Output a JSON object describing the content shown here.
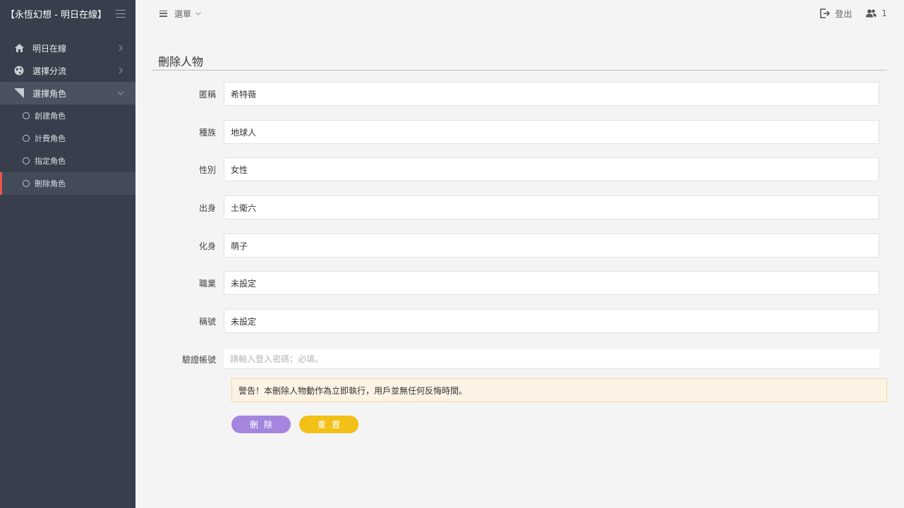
{
  "sidebar": {
    "brand": "【永恆幻想 - 明日在線】",
    "items": [
      {
        "label": "明日在線",
        "icon": "home-icon"
      },
      {
        "label": "選擇分流",
        "icon": "globe-icon"
      },
      {
        "label": "選擇角色",
        "icon": "corner-icon"
      }
    ],
    "sub_items": [
      {
        "label": "創建角色"
      },
      {
        "label": "計費角色"
      },
      {
        "label": "指定角色"
      },
      {
        "label": "刪除角色"
      }
    ]
  },
  "topbar": {
    "menu_label": "選單",
    "logout_label": "登出",
    "online_count": "1"
  },
  "page": {
    "title": "刪除人物"
  },
  "form": {
    "fields": [
      {
        "label": "匿稱",
        "value": "希特薇"
      },
      {
        "label": "種族",
        "value": "地球人"
      },
      {
        "label": "性別",
        "value": "女性"
      },
      {
        "label": "出身",
        "value": "土衛六"
      },
      {
        "label": "化身",
        "value": "萌子"
      },
      {
        "label": "職業",
        "value": "未設定"
      },
      {
        "label": "稱號",
        "value": "未設定"
      }
    ],
    "password": {
      "label": "驗證帳號",
      "placeholder": "請輸入登入密碼；必填。",
      "value": ""
    },
    "warning": "警告！本刪除人物動作為立即執行，用戶並無任何反悔時間。",
    "delete_label": "刪除",
    "reset_label": "重置"
  },
  "colors": {
    "sidebar_bg": "#383e4b",
    "active_marker": "#e8574f",
    "delete_button": "#a486de",
    "reset_button": "#f2c017",
    "warning_bg": "#fdf3e4"
  }
}
